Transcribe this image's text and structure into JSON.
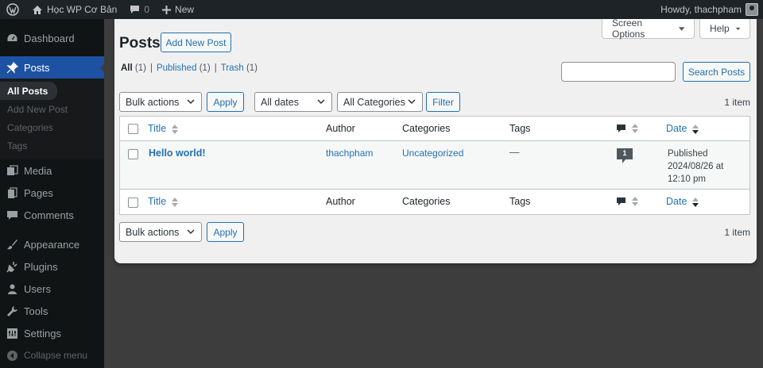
{
  "adminbar": {
    "site_name": "Học WP Cơ Bản",
    "comments_count": "0",
    "new_label": "New",
    "howdy": "Howdy, thachpham"
  },
  "sidebar": {
    "items": [
      {
        "label": "Dashboard",
        "icon": "dashboard-icon"
      },
      {
        "label": "Posts",
        "icon": "pin-icon"
      },
      {
        "label": "Media",
        "icon": "media-icon"
      },
      {
        "label": "Pages",
        "icon": "pages-icon"
      },
      {
        "label": "Comments",
        "icon": "comments-icon"
      },
      {
        "label": "Appearance",
        "icon": "brush-icon"
      },
      {
        "label": "Plugins",
        "icon": "plugin-icon"
      },
      {
        "label": "Users",
        "icon": "users-icon"
      },
      {
        "label": "Tools",
        "icon": "wrench-icon"
      },
      {
        "label": "Settings",
        "icon": "settings-icon"
      },
      {
        "label": "Collapse menu",
        "icon": "collapse-icon"
      }
    ],
    "posts_submenu": [
      "All Posts",
      "Add New Post",
      "Categories",
      "Tags"
    ]
  },
  "header": {
    "screen_options": "Screen Options",
    "help": "Help",
    "title": "Posts",
    "add_new": "Add New Post"
  },
  "filters": {
    "all_label": "All",
    "all_count": "(1)",
    "published_label": "Published",
    "published_count": "(1)",
    "trash_label": "Trash",
    "trash_count": "(1)",
    "separator": "|"
  },
  "search": {
    "button": "Search Posts",
    "value": ""
  },
  "tablenav": {
    "bulk_actions": "Bulk actions",
    "apply": "Apply",
    "all_dates": "All dates",
    "all_categories": "All Categories",
    "filter": "Filter",
    "items_count": "1 item"
  },
  "table": {
    "columns": {
      "title": "Title",
      "author": "Author",
      "categories": "Categories",
      "tags": "Tags",
      "date": "Date"
    },
    "rows": [
      {
        "title": "Hello world!",
        "author": "thachpham",
        "categories": "Uncategorized",
        "tags": "—",
        "comments": "1",
        "status": "Published",
        "date": "2024/08/26 at",
        "time": "12:10 pm"
      }
    ]
  },
  "colors": {
    "accent": "#2271b1",
    "sidebar_active": "#1d52a3",
    "adminbar": "#1d2327"
  }
}
